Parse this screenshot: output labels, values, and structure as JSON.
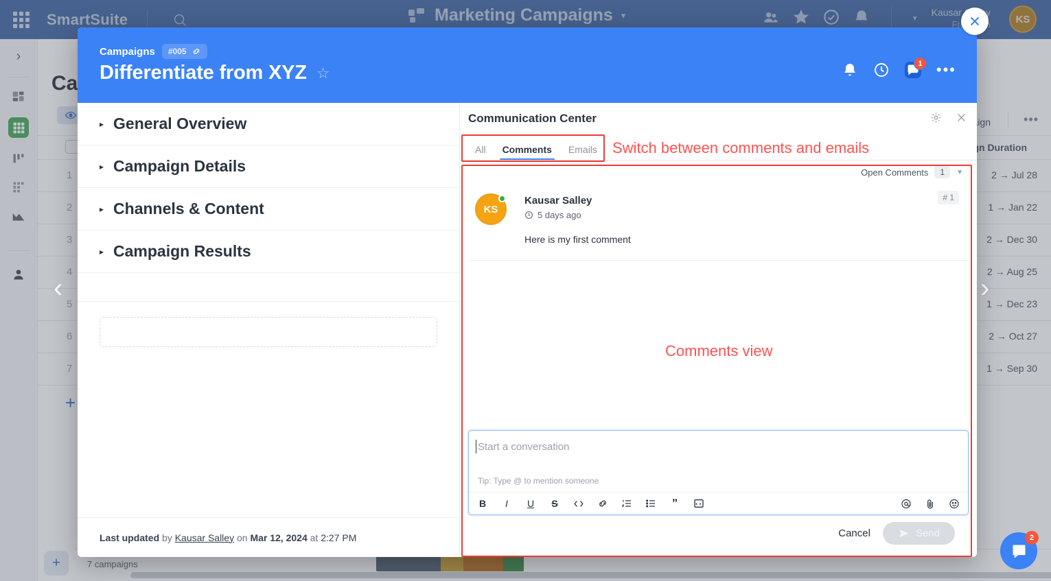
{
  "topbar": {
    "brand": "SmartSuite",
    "doc_title": "Marketing Campaigns",
    "user_name": "Kausar Salley",
    "user_sub": "Free Plan",
    "user_initials": "KS",
    "icons": [
      "grid-launcher-icon",
      "search-icon",
      "members-icon",
      "star-icon",
      "tasks-icon",
      "notifications-icon"
    ]
  },
  "background": {
    "page_title": "Campaigns",
    "column_header": "Campaign Duration",
    "row_numbers": [
      "1",
      "2",
      "3",
      "4",
      "5",
      "6",
      "7"
    ],
    "durations": [
      "2 → Jul 28",
      "1 → Jan 22",
      "2 → Dec 30",
      "2 → Aug 25",
      "1 → Dec 23",
      "2 → Oct 27",
      "1 → Sep 30"
    ],
    "footer_count": "7 campaigns",
    "right_label": "mpaign",
    "status_colors": [
      "#3d4f5f",
      "#c8961e",
      "#b45f06",
      "#2a8033"
    ],
    "rail_items": [
      "expand-icon",
      "cards-icon",
      "grid-icon",
      "kanban-icon",
      "dots-grid-icon",
      "chart-icon",
      "person-icon"
    ]
  },
  "modal": {
    "breadcrumb": "Campaigns",
    "record_id": "#005",
    "title": "Differentiate from XYZ",
    "header_icons": [
      "bell-icon",
      "clock-icon",
      "comment-icon",
      "more-icon"
    ],
    "comment_badge": "1",
    "sections": [
      {
        "label": "General Overview"
      },
      {
        "label": "Campaign Details"
      },
      {
        "label": "Channels & Content"
      },
      {
        "label": "Campaign Results"
      }
    ],
    "last_updated": {
      "prefix": "Last updated",
      "by": "by",
      "user": "Kausar Salley",
      "on": "on",
      "date": "Mar 12, 2024",
      "at": "at",
      "time": "2:27 PM"
    }
  },
  "communication_center": {
    "title": "Communication Center",
    "tabs": [
      {
        "label": "All",
        "active": false
      },
      {
        "label": "Comments",
        "active": true
      },
      {
        "label": "Emails",
        "active": false
      }
    ],
    "filter": {
      "label": "Open Comments",
      "count": "1"
    },
    "comments": [
      {
        "author": "Kausar Salley",
        "initials": "KS",
        "time": "5 days ago",
        "body": "Here is my first comment",
        "number": "# 1"
      }
    ],
    "composer": {
      "placeholder": "Start a conversation",
      "tip": "Tip: Type @ to mention someone",
      "toolbar": [
        "bold",
        "italic",
        "underline",
        "strikethrough",
        "code",
        "link",
        "ordered-list",
        "bullet-list",
        "quote",
        "code-block"
      ],
      "toolbar_right": [
        "mention-icon",
        "attachment-icon",
        "emoji-icon"
      ],
      "cancel_label": "Cancel",
      "send_label": "Send"
    }
  },
  "annotations": [
    {
      "text": "Switch between comments and emails"
    },
    {
      "text": "Comments view"
    }
  ],
  "widgets": {
    "intercom_badge": "2"
  },
  "colors": {
    "accent": "#3b82f6",
    "topbar": "#2b5599",
    "annotation": "#ff5252",
    "avatar": "#f5a310",
    "active_grid": "#2f9e44"
  }
}
